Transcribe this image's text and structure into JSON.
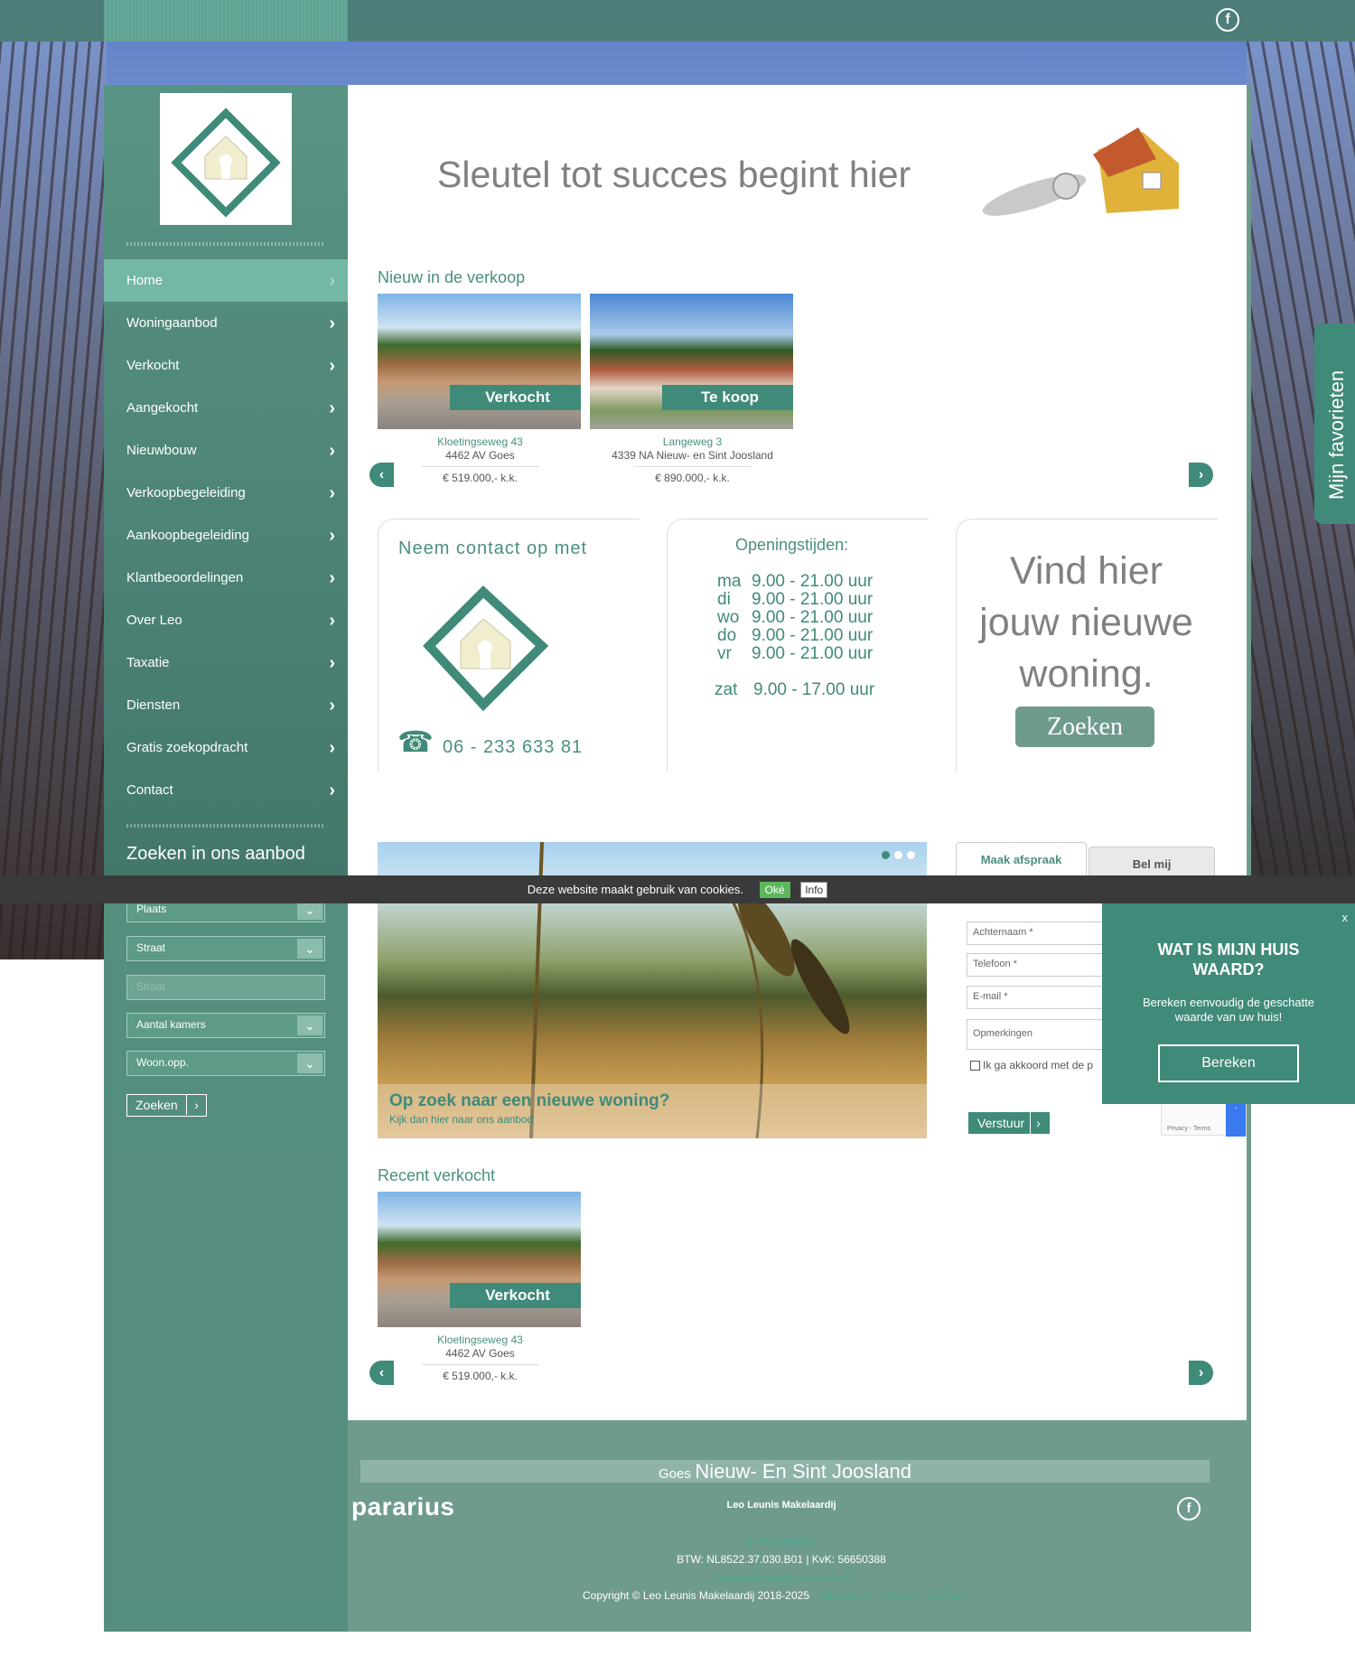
{
  "top": {
    "facebook_icon": "facebook-icon"
  },
  "nav": {
    "items": [
      {
        "label": "Home",
        "active": true
      },
      {
        "label": "Woningaanbod"
      },
      {
        "label": "Verkocht"
      },
      {
        "label": "Aangekocht"
      },
      {
        "label": "Nieuwbouw"
      },
      {
        "label": "Verkoopbegeleiding"
      },
      {
        "label": "Aankoopbegeleiding"
      },
      {
        "label": "Klantbeoordelingen"
      },
      {
        "label": "Over Leo"
      },
      {
        "label": "Taxatie"
      },
      {
        "label": "Diensten"
      },
      {
        "label": "Gratis zoekopdracht"
      },
      {
        "label": "Contact"
      }
    ]
  },
  "search": {
    "title": "Zoeken in ons aanbod",
    "plaats": "Plaats",
    "straat_select": "Straat",
    "straat_placeholder": "Straat",
    "kamers": "Aantal kamers",
    "woonopp": "Woon.opp.",
    "button": "Zoeken"
  },
  "hero": {
    "headline": "Sleutel tot succes begint hier"
  },
  "new_listings": {
    "title": "Nieuw in de verkoop",
    "cards": [
      {
        "badge": "Verkocht",
        "address": "Kloetingseweg 43",
        "zip": "4462 AV Goes",
        "price": "€ 519.000,- k.k."
      },
      {
        "badge": "Te koop",
        "address": "Langeweg 3",
        "zip": "4339 NA Nieuw- en Sint Joosland",
        "price": "€ 890.000,- k.k."
      }
    ]
  },
  "contact": {
    "title": "Neem contact op met",
    "phone": "06 - 233 633 81"
  },
  "hours": {
    "title": "Openingstijden:",
    "rows": [
      {
        "day": "ma",
        "time": "9.00 - 21.00 uur"
      },
      {
        "day": "di",
        "time": "9.00 - 21.00 uur"
      },
      {
        "day": "wo",
        "time": "9.00 - 21.00 uur"
      },
      {
        "day": "do",
        "time": "9.00 - 21.00 uur"
      },
      {
        "day": "vr",
        "time": "9.00 - 21.00 uur"
      }
    ],
    "saturday": {
      "day": "zat",
      "time": "9.00 - 17.00 uur"
    }
  },
  "finder": {
    "line1": "Vind hier",
    "line2": "jouw nieuwe",
    "line3": "woning.",
    "button": "Zoeken"
  },
  "banner": {
    "heading": "Op zoek naar een nieuwe woning?",
    "sub": "Kijk dan hier naar ons aanbod"
  },
  "form": {
    "tab_active": "Maak afspraak",
    "tab_inactive": "Bel mij",
    "fields": [
      "Achternaam *",
      "Telefoon *",
      "E-mail *",
      "Opmerkingen"
    ],
    "agree": "Ik ga akkoord met de p",
    "submit": "Verstuur",
    "recaptcha": "Privacy - Terms"
  },
  "cookie": {
    "text": "Deze website maakt gebruik van cookies.",
    "ok": "Oké",
    "info": "Info"
  },
  "popup": {
    "close": "x",
    "title": "WAT IS MIJN HUIS WAARD?",
    "subtitle": "Bereken eenvoudig de geschatte waarde van uw huis!",
    "button": "Bereken"
  },
  "favorites": {
    "label": "Mijn favorieten"
  },
  "recent": {
    "title": "Recent verkocht",
    "cards": [
      {
        "badge": "Verkocht",
        "address": "Kloetingseweg 43",
        "zip": "4462 AV Goes",
        "price": "€ 519.000,- k.k."
      }
    ]
  },
  "footer": {
    "places_small": "Goes",
    "places_big": "Nieuw- En Sint Joosland",
    "pararius": "pararius",
    "company": "Leo Leunis Makelaardij",
    "phone": "0623363381",
    "btw": "BTW: NL8522.37.030.B01 | KvK: 56650388",
    "email": "info@leoleunismakelaardij.nl",
    "copyright": "Copyright © Leo Leunis Makelaardij 2018-2025",
    "links": [
      "Disclaimer",
      "Privacy",
      "Contact"
    ]
  },
  "colors": {
    "brand": "#3f8a79",
    "panel": "#6f9b8f",
    "accent_text": "#4b8f80"
  }
}
